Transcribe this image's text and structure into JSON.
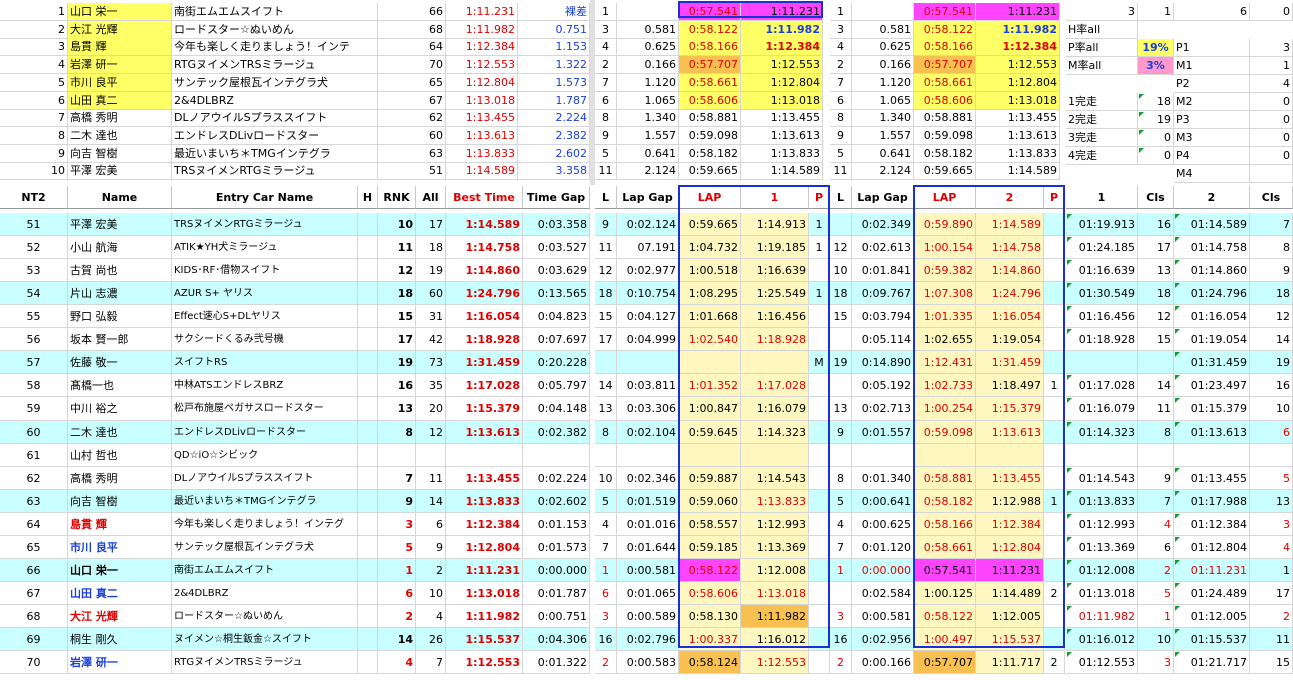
{
  "top_drivers": [
    {
      "num": "1",
      "name": "山口 栄一",
      "car": "南街エムエムスイフト",
      "car_no": "66",
      "time": "1:11.231",
      "gap": "裸差"
    },
    {
      "num": "2",
      "name": "大江 光輝",
      "car": "ロードスター☆ぬいめん",
      "car_no": "68",
      "time": "1:11.982",
      "gap": "0.751"
    },
    {
      "num": "3",
      "name": "島貫 輝",
      "car": "今年も楽しく走りましょう！インテ",
      "car_no": "64",
      "time": "1:12.384",
      "gap": "1.153"
    },
    {
      "num": "4",
      "name": "岩澤 研一",
      "car": "RTGヌイメンTRSミラージュ",
      "car_no": "70",
      "time": "1:12.553",
      "gap": "1.322"
    },
    {
      "num": "5",
      "name": "市川 良平",
      "car": "サンテック屋根瓦インテグラ犬",
      "car_no": "65",
      "time": "1:12.804",
      "gap": "1.573"
    },
    {
      "num": "6",
      "name": "山田 真二",
      "car": "2&4DLBRZ",
      "car_no": "67",
      "time": "1:13.018",
      "gap": "1.787"
    },
    {
      "num": "7",
      "name": "高橋 秀明",
      "car": "DLノアウイルSプラススイフト",
      "car_no": "62",
      "time": "1:13.455",
      "gap": "2.224"
    },
    {
      "num": "8",
      "name": "二木 達也",
      "car": "エンドレスDLivロードスター",
      "car_no": "60",
      "time": "1:13.613",
      "gap": "2.382"
    },
    {
      "num": "9",
      "name": "向吉 智樹",
      "car": "最近いまいち＊TMGインテグラ",
      "car_no": "63",
      "time": "1:13.833",
      "gap": "2.602"
    },
    {
      "num": "10",
      "name": "平澤 宏美",
      "car": "TRSヌイメンRTGミラージュ",
      "car_no": "51",
      "time": "1:14.589",
      "gap": "3.358"
    }
  ],
  "top_laps": [
    {
      "l": "1",
      "gap": "",
      "lap": "0:57.541",
      "best": "1:11.231",
      "l2": "1",
      "gap2": "",
      "lap2": "0:57.541",
      "best2": "1:11.231"
    },
    {
      "l": "3",
      "gap": "0.581",
      "lap": "0:58.122",
      "best": "1:11.982",
      "l2": "3",
      "gap2": "0.581",
      "lap2": "0:58.122",
      "best2": "1:11.982"
    },
    {
      "l": "4",
      "gap": "0.625",
      "lap": "0:58.166",
      "best": "1:12.384",
      "l2": "4",
      "gap2": "0.625",
      "lap2": "0:58.166",
      "best2": "1:12.384"
    },
    {
      "l": "2",
      "gap": "0.166",
      "lap": "0:57.707",
      "best": "1:12.553",
      "l2": "2",
      "gap2": "0.166",
      "lap2": "0:57.707",
      "best2": "1:12.553"
    },
    {
      "l": "7",
      "gap": "1.120",
      "lap": "0:58.661",
      "best": "1:12.804",
      "l2": "7",
      "gap2": "1.120",
      "lap2": "0:58.661",
      "best2": "1:12.804"
    },
    {
      "l": "6",
      "gap": "1.065",
      "lap": "0:58.606",
      "best": "1:13.018",
      "l2": "6",
      "gap2": "1.065",
      "lap2": "0:58.606",
      "best2": "1:13.018"
    },
    {
      "l": "8",
      "gap": "1.340",
      "lap": "0:58.881",
      "best": "1:13.455",
      "l2": "8",
      "gap2": "1.340",
      "lap2": "0:58.881",
      "best2": "1:13.455"
    },
    {
      "l": "9",
      "gap": "1.557",
      "lap": "0:59.098",
      "best": "1:13.613",
      "l2": "9",
      "gap2": "1.557",
      "lap2": "0:59.098",
      "best2": "1:13.613"
    },
    {
      "l": "5",
      "gap": "0.641",
      "lap": "0:58.182",
      "best": "1:13.833",
      "l2": "5",
      "gap2": "0.641",
      "lap2": "0:58.182",
      "best2": "1:13.833"
    },
    {
      "l": "11",
      "gap": "2.124",
      "lap": "0:59.665",
      "best": "1:14.589",
      "l2": "11",
      "gap2": "2.124",
      "lap2": "0:59.665",
      "best2": "1:14.589"
    }
  ],
  "stats": {
    "row1": [
      "3",
      "1",
      "6",
      "0"
    ],
    "h_label": "H率all",
    "p_label": "P率all",
    "p_value": "19%",
    "p1": "P1",
    "p1v": "3",
    "m_label": "M率all",
    "m_value": "3%",
    "m1": "M1",
    "m1v": "1",
    "p2": "P2",
    "p2v": "4",
    "k1": "1完走",
    "k1v": "18",
    "m2": "M2",
    "m2v": "0",
    "k2": "2完走",
    "k2v": "19",
    "p3": "P3",
    "p3v": "0",
    "k3": "3完走",
    "k3v": "0",
    "m3": "M3",
    "m3v": "0",
    "k4": "4完走",
    "k4v": "0",
    "p4": "P4",
    "p4v": "0",
    "m4": "M4",
    "m4v": ""
  },
  "headers": {
    "nt2": "NT2",
    "name": "Name",
    "car": "Entry Car Name",
    "h": "H",
    "rnk": "RNK",
    "all": "All",
    "best": "Best Time",
    "timegap": "Time Gap",
    "l": "L",
    "lapgap": "Lap Gap",
    "lap": "LAP",
    "one": "1",
    "p": "P",
    "l2": "L",
    "lapgap2": "Lap Gap",
    "lap2": "LAP",
    "two": "2",
    "p2": "P",
    "s1": "1",
    "cls1": "Cls",
    "s2": "2",
    "cls2": "Cls"
  },
  "rows": [
    {
      "nt2": "51",
      "name": "平澤 宏美",
      "car": "TRSヌイメンRTGミラージュ",
      "h": "",
      "rnk": "10",
      "all": "17",
      "best": "1:14.589",
      "tgap": "0:03.358",
      "l1": "9",
      "lg1": "0:02.124",
      "lap1": "0:59.665",
      "t1": "1:14.913",
      "p1": "1",
      "l2": "",
      "lg2": "0:02.349",
      "lap2": "0:59.890",
      "t2": "1:14.589",
      "p2": "",
      "s1": "01:19.913",
      "c1": "16",
      "s2": "01:14.589",
      "c2": "7"
    },
    {
      "nt2": "52",
      "name": "小山 航海",
      "car": "ATIK★YH犬ミラージュ",
      "h": "",
      "rnk": "11",
      "all": "18",
      "best": "1:14.758",
      "tgap": "0:03.527",
      "l1": "11",
      "lg1": "07.191",
      "lap1": "1:04.732",
      "t1": "1:19.185",
      "p1": "1",
      "l2": "12",
      "lg2": "0:02.613",
      "lap2": "1:00.154",
      "t2": "1:14.758",
      "p2": "",
      "s1": "01:24.185",
      "c1": "17",
      "s2": "01:14.758",
      "c2": "8"
    },
    {
      "nt2": "53",
      "name": "古賀 尚也",
      "car": "KIDS･RF･借物スイフト",
      "h": "",
      "rnk": "12",
      "all": "19",
      "best": "1:14.860",
      "tgap": "0:03.629",
      "l1": "12",
      "lg1": "0:02.977",
      "lap1": "1:00.518",
      "t1": "1:16.639",
      "p1": "",
      "l2": "10",
      "lg2": "0:01.841",
      "lap2": "0:59.382",
      "t2": "1:14.860",
      "p2": "",
      "s1": "01:16.639",
      "c1": "13",
      "s2": "01:14.860",
      "c2": "9"
    },
    {
      "nt2": "54",
      "name": "片山 志濃",
      "car": "AZUR S+ ヤリス",
      "h": "",
      "rnk": "18",
      "all": "60",
      "best": "1:24.796",
      "tgap": "0:13.565",
      "l1": "18",
      "lg1": "0:10.754",
      "lap1": "1:08.295",
      "t1": "1:25.549",
      "p1": "1",
      "l2": "18",
      "lg2": "0:09.767",
      "lap2": "1:07.308",
      "t2": "1:24.796",
      "p2": "",
      "s1": "01:30.549",
      "c1": "18",
      "s2": "01:24.796",
      "c2": "18"
    },
    {
      "nt2": "55",
      "name": "野口 弘毅",
      "car": "Effect速心S+DLヤリス",
      "h": "",
      "rnk": "15",
      "all": "31",
      "best": "1:16.054",
      "tgap": "0:04.823",
      "l1": "15",
      "lg1": "0:04.127",
      "lap1": "1:01.668",
      "t1": "1:16.456",
      "p1": "",
      "l2": "15",
      "lg2": "0:03.794",
      "lap2": "1:01.335",
      "t2": "1:16.054",
      "p2": "",
      "s1": "01:16.456",
      "c1": "12",
      "s2": "01:16.054",
      "c2": "12"
    },
    {
      "nt2": "56",
      "name": "坂本 賢一郎",
      "car": "サクシードくるみ弐号機",
      "h": "",
      "rnk": "17",
      "all": "42",
      "best": "1:18.928",
      "tgap": "0:07.697",
      "l1": "17",
      "lg1": "0:04.999",
      "lap1": "1:02.540",
      "t1": "1:18.928",
      "p1": "",
      "l2": "",
      "lg2": "0:05.114",
      "lap2": "1:02.655",
      "t2": "1:19.054",
      "p2": "",
      "s1": "01:18.928",
      "c1": "15",
      "s2": "01:19.054",
      "c2": "14"
    },
    {
      "nt2": "57",
      "name": "佐藤 敬一",
      "car": "スイフトRS",
      "h": "",
      "rnk": "19",
      "all": "73",
      "best": "1:31.459",
      "tgap": "0:20.228",
      "l1": "",
      "lg1": "",
      "lap1": "",
      "t1": "",
      "p1": "M",
      "l2": "19",
      "lg2": "0:14.890",
      "lap2": "1:12.431",
      "t2": "1:31.459",
      "p2": "",
      "s1": "",
      "c1": "",
      "s2": "01:31.459",
      "c2": "19"
    },
    {
      "nt2": "58",
      "name": "髙橋一也",
      "car": "中林ATSエンドレスBRZ",
      "h": "",
      "rnk": "16",
      "all": "35",
      "best": "1:17.028",
      "tgap": "0:05.797",
      "l1": "14",
      "lg1": "0:03.811",
      "lap1": "1:01.352",
      "t1": "1:17.028",
      "p1": "",
      "l2": "",
      "lg2": "0:05.192",
      "lap2": "1:02.733",
      "t2": "1:18.497",
      "p2": "1",
      "s1": "01:17.028",
      "c1": "14",
      "s2": "01:23.497",
      "c2": "16"
    },
    {
      "nt2": "59",
      "name": "中川 裕之",
      "car": "松戸布施屋ペガサスロードスター",
      "h": "",
      "rnk": "13",
      "all": "20",
      "best": "1:15.379",
      "tgap": "0:04.148",
      "l1": "13",
      "lg1": "0:03.306",
      "lap1": "1:00.847",
      "t1": "1:16.079",
      "p1": "",
      "l2": "13",
      "lg2": "0:02.713",
      "lap2": "1:00.254",
      "t2": "1:15.379",
      "p2": "",
      "s1": "01:16.079",
      "c1": "11",
      "s2": "01:15.379",
      "c2": "10"
    },
    {
      "nt2": "60",
      "name": "二木 達也",
      "car": "エンドレスDLivロードスター",
      "h": "",
      "rnk": "8",
      "all": "12",
      "best": "1:13.613",
      "tgap": "0:02.382",
      "l1": "8",
      "lg1": "0:02.104",
      "lap1": "0:59.645",
      "t1": "1:14.323",
      "p1": "",
      "l2": "9",
      "lg2": "0:01.557",
      "lap2": "0:59.098",
      "t2": "1:13.613",
      "p2": "",
      "s1": "01:14.323",
      "c1": "8",
      "s2": "01:13.613",
      "c2": "6"
    },
    {
      "nt2": "61",
      "name": "山村 哲也",
      "car": "QD☆iO☆シビック",
      "h": "",
      "rnk": "",
      "all": "",
      "best": "",
      "tgap": "",
      "l1": "",
      "lg1": "",
      "lap1": "",
      "t1": "",
      "p1": "",
      "l2": "",
      "lg2": "",
      "lap2": "",
      "t2": "",
      "p2": "",
      "s1": "",
      "c1": "",
      "s2": "",
      "c2": ""
    },
    {
      "nt2": "62",
      "name": "高橋 秀明",
      "car": "DLノアウイルSプラススイフト",
      "h": "",
      "rnk": "7",
      "all": "11",
      "best": "1:13.455",
      "tgap": "0:02.224",
      "l1": "10",
      "lg1": "0:02.346",
      "lap1": "0:59.887",
      "t1": "1:14.543",
      "p1": "",
      "l2": "8",
      "lg2": "0:01.340",
      "lap2": "0:58.881",
      "t2": "1:13.455",
      "p2": "",
      "s1": "01:14.543",
      "c1": "9",
      "s2": "01:13.455",
      "c2": "5"
    },
    {
      "nt2": "63",
      "name": "向吉 智樹",
      "car": "最近いまいち＊TMGインテグラ",
      "h": "",
      "rnk": "9",
      "all": "14",
      "best": "1:13.833",
      "tgap": "0:02.602",
      "l1": "5",
      "lg1": "0:01.519",
      "lap1": "0:59.060",
      "t1": "1:13.833",
      "p1": "",
      "l2": "5",
      "lg2": "0:00.641",
      "lap2": "0:58.182",
      "t2": "1:12.988",
      "p2": "1",
      "s1": "01:13.833",
      "c1": "7",
      "s2": "01:17.988",
      "c2": "13"
    },
    {
      "nt2": "64",
      "name": "島貫 輝",
      "car": "今年も楽しく走りましょう！インテグ",
      "h": "",
      "rnk": "3",
      "all": "6",
      "best": "1:12.384",
      "tgap": "0:01.153",
      "l1": "4",
      "lg1": "0:01.016",
      "lap1": "0:58.557",
      "t1": "1:12.993",
      "p1": "",
      "l2": "4",
      "lg2": "0:00.625",
      "lap2": "0:58.166",
      "t2": "1:12.384",
      "p2": "",
      "s1": "01:12.993",
      "c1": "4",
      "s2": "01:12.384",
      "c2": "3"
    },
    {
      "nt2": "65",
      "name": "市川 良平",
      "car": "サンテック屋根瓦インテグラ犬",
      "h": "",
      "rnk": "5",
      "all": "9",
      "best": "1:12.804",
      "tgap": "0:01.573",
      "l1": "7",
      "lg1": "0:01.644",
      "lap1": "0:59.185",
      "t1": "1:13.369",
      "p1": "",
      "l2": "7",
      "lg2": "0:01.120",
      "lap2": "0:58.661",
      "t2": "1:12.804",
      "p2": "",
      "s1": "01:13.369",
      "c1": "6",
      "s2": "01:12.804",
      "c2": "4"
    },
    {
      "nt2": "66",
      "name": "山口 栄一",
      "car": "南街エムエムスイフト",
      "h": "",
      "rnk": "1",
      "all": "2",
      "best": "1:11.231",
      "tgap": "0:00.000",
      "l1": "1",
      "lg1": "0:00.581",
      "lap1": "0:58.122",
      "t1": "1:12.008",
      "p1": "",
      "l2": "1",
      "lg2": "0:00.000",
      "lap2": "0:57.541",
      "t2": "1:11.231",
      "p2": "",
      "s1": "01:12.008",
      "c1": "2",
      "s2": "01:11.231",
      "c2": "1"
    },
    {
      "nt2": "67",
      "name": "山田 真二",
      "car": "2&4DLBRZ",
      "h": "",
      "rnk": "6",
      "all": "10",
      "best": "1:13.018",
      "tgap": "0:01.787",
      "l1": "6",
      "lg1": "0:01.065",
      "lap1": "0:58.606",
      "t1": "1:13.018",
      "p1": "",
      "l2": "",
      "lg2": "0:02.584",
      "lap2": "1:00.125",
      "t2": "1:14.489",
      "p2": "2",
      "s1": "01:13.018",
      "c1": "5",
      "s2": "01:24.489",
      "c2": "17"
    },
    {
      "nt2": "68",
      "name": "大江 光輝",
      "car": "ロードスター☆ぬいめん",
      "h": "",
      "rnk": "2",
      "all": "4",
      "best": "1:11.982",
      "tgap": "0:00.751",
      "l1": "3",
      "lg1": "0:00.589",
      "lap1": "0:58.130",
      "t1": "1:11.982",
      "p1": "",
      "l2": "3",
      "lg2": "0:00.581",
      "lap2": "0:58.122",
      "t2": "1:12.005",
      "p2": "",
      "s1": "01:11.982",
      "c1": "1",
      "s2": "01:12.005",
      "c2": "2"
    },
    {
      "nt2": "69",
      "name": "桐生 剛久",
      "car": "ヌイメン☆桐生鈑金☆スイフト",
      "h": "",
      "rnk": "14",
      "all": "26",
      "best": "1:15.537",
      "tgap": "0:04.306",
      "l1": "16",
      "lg1": "0:02.796",
      "lap1": "1:00.337",
      "t1": "1:16.012",
      "p1": "",
      "l2": "16",
      "lg2": "0:02.956",
      "lap2": "1:00.497",
      "t2": "1:15.537",
      "p2": "",
      "s1": "01:16.012",
      "c1": "10",
      "s2": "01:15.537",
      "c2": "11"
    },
    {
      "nt2": "70",
      "name": "岩澤 研一",
      "car": "RTGヌイメンTRSミラージュ",
      "h": "",
      "rnk": "4",
      "all": "7",
      "best": "1:12.553",
      "tgap": "0:01.322",
      "l1": "2",
      "lg1": "0:00.583",
      "lap1": "0:58.124",
      "t1": "1:12.553",
      "p1": "",
      "l2": "2",
      "lg2": "0:00.166",
      "lap2": "0:57.707",
      "t2": "1:11.717",
      "p2": "2",
      "s1": "01:12.553",
      "c1": "3",
      "s2": "01:21.717",
      "c2": "15"
    }
  ],
  "colors": {
    "yellow": "#ffff66",
    "magenta": "#ff44ff",
    "cyan": "#c9ffff",
    "lightyellow": "#fff7c0",
    "orange": "#f8c050",
    "pink": "#ff99cc",
    "red": "#e00000",
    "blue": "#1a3fd8",
    "boxblue": "#1a2fd8"
  }
}
